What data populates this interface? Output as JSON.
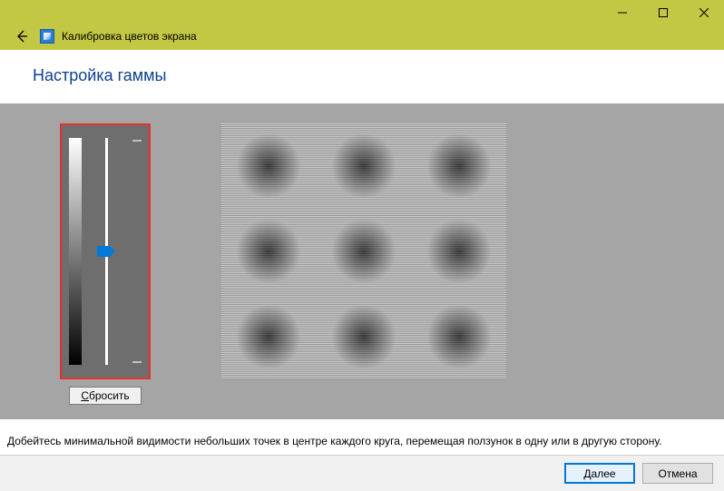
{
  "window": {
    "title": "Калибровка цветов экрана"
  },
  "page": {
    "title": "Настройка гаммы"
  },
  "slider": {
    "reset_label_underline": "С",
    "reset_label_rest": "бросить"
  },
  "instruction": "Добейтесь минимальной видимости небольших точек в центре каждого круга, перемещая ползунок в одну или в другую сторону.",
  "buttons": {
    "next_underline": "Д",
    "next_rest": "алее",
    "cancel": "Отмена"
  }
}
